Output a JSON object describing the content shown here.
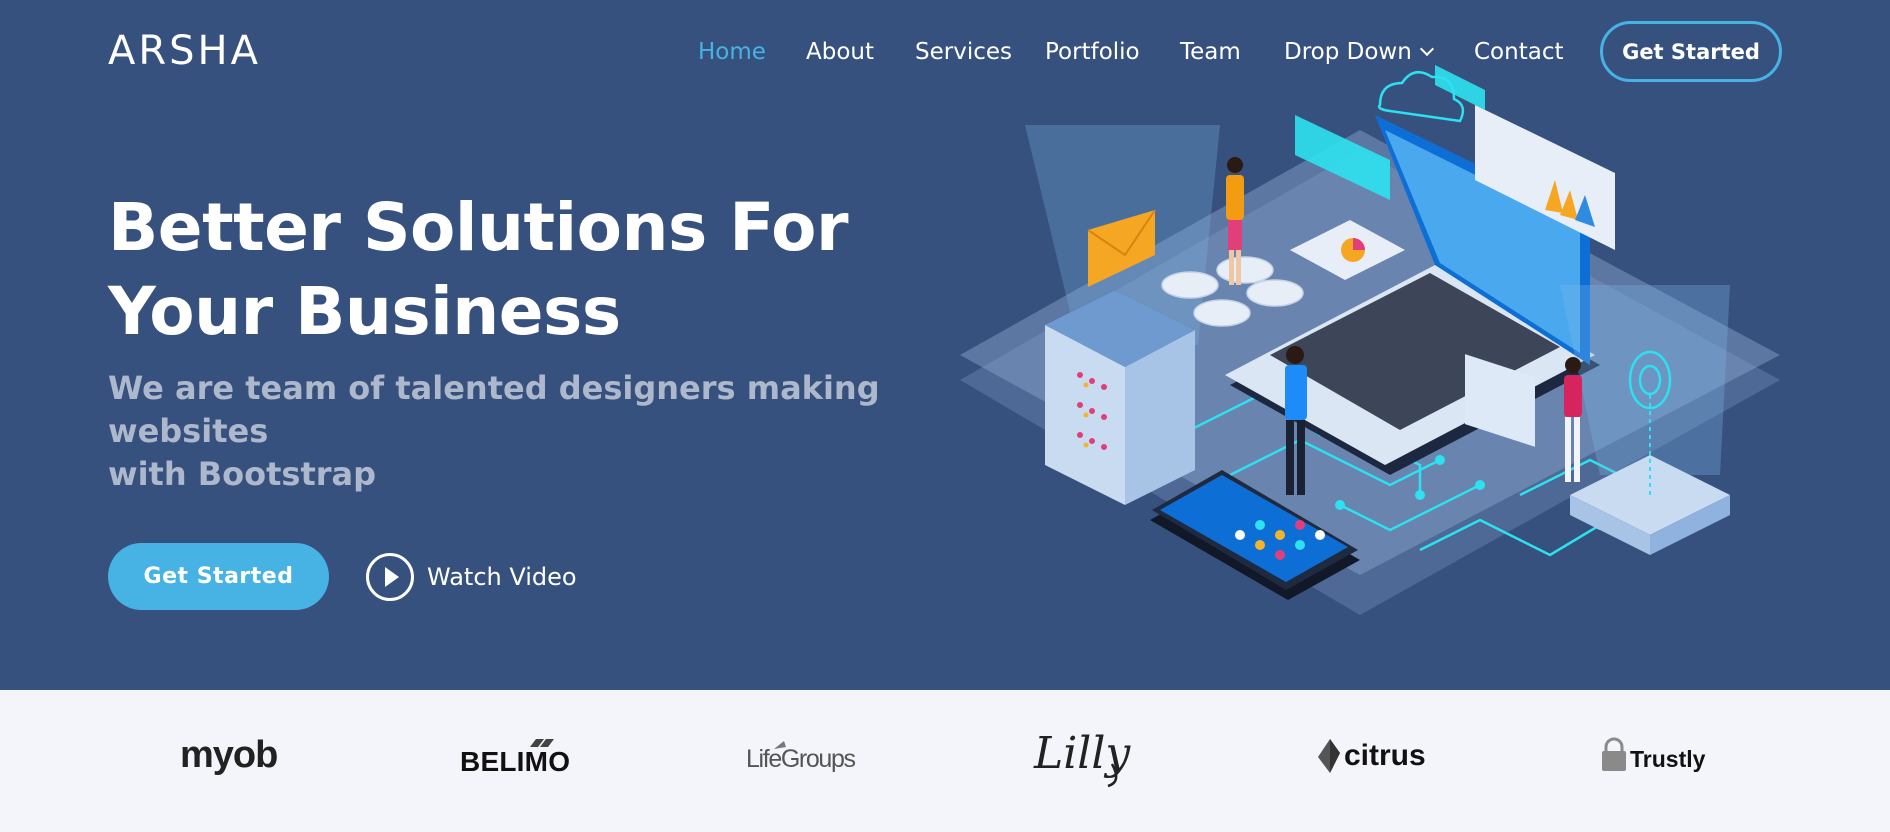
{
  "brand": {
    "logo": "ARSHA"
  },
  "nav": {
    "items": [
      {
        "label": "Home",
        "active": true
      },
      {
        "label": "About"
      },
      {
        "label": "Services"
      },
      {
        "label": "Portfolio"
      },
      {
        "label": "Team"
      },
      {
        "label": "Drop Down",
        "has_dropdown": true
      },
      {
        "label": "Contact"
      }
    ],
    "cta": "Get Started"
  },
  "hero": {
    "title_line1": "Better Solutions For",
    "title_line2": "Your Business",
    "subtitle_line1": "We are team of talented designers making websites",
    "subtitle_line2": "with Bootstrap",
    "primary_button": "Get Started",
    "video_button": "Watch Video"
  },
  "clients": [
    {
      "name": "myob",
      "icon": "myob-logo"
    },
    {
      "name": "BELIMO",
      "icon": "belimo-logo"
    },
    {
      "name": "LifeGroups",
      "icon": "lifegroups-logo"
    },
    {
      "name": "Lilly",
      "icon": "lilly-logo"
    },
    {
      "name": "citrus",
      "icon": "citrus-logo"
    },
    {
      "name": "Trustly",
      "icon": "trustly-logo"
    }
  ],
  "colors": {
    "hero_bg": "#37517e",
    "accent": "#47b2e4",
    "subtitle": "#aeb8cc",
    "clients_bg": "#f3f5fa"
  }
}
